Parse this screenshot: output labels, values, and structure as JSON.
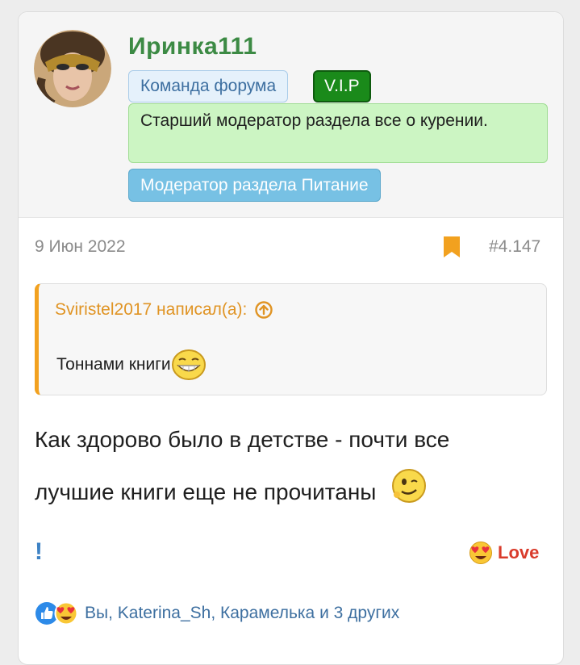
{
  "user": {
    "name": "Иринка111",
    "badges": {
      "team": "Команда форума",
      "vip": "V.I.P",
      "moderator": "Старший модератор раздела все о курении.",
      "food": "Модератор раздела Питание"
    }
  },
  "post": {
    "date": "9 Июн 2022",
    "number": "#4.147",
    "quote": {
      "author": "Sviristel2017 написал(а):",
      "text": "Тоннами книги"
    },
    "body_line1": "Как здорово было в детстве - почти все",
    "body_line2": "лучшие книги еще не прочитаны",
    "flag": "!",
    "reaction_label": "Love",
    "reactions_summary": "Вы, Katerina_Sh, Карамелька и 3 других"
  },
  "colors": {
    "username": "#3c8a44",
    "quote_accent": "#f2a11f",
    "love": "#d93b2b",
    "link": "#3d6fa0"
  },
  "icons": [
    "avatar",
    "bookmark-icon",
    "arrow-up-circle-icon",
    "grin-smiley-icon",
    "wink-smiley-icon",
    "heart-eyes-icon",
    "like-icon"
  ]
}
